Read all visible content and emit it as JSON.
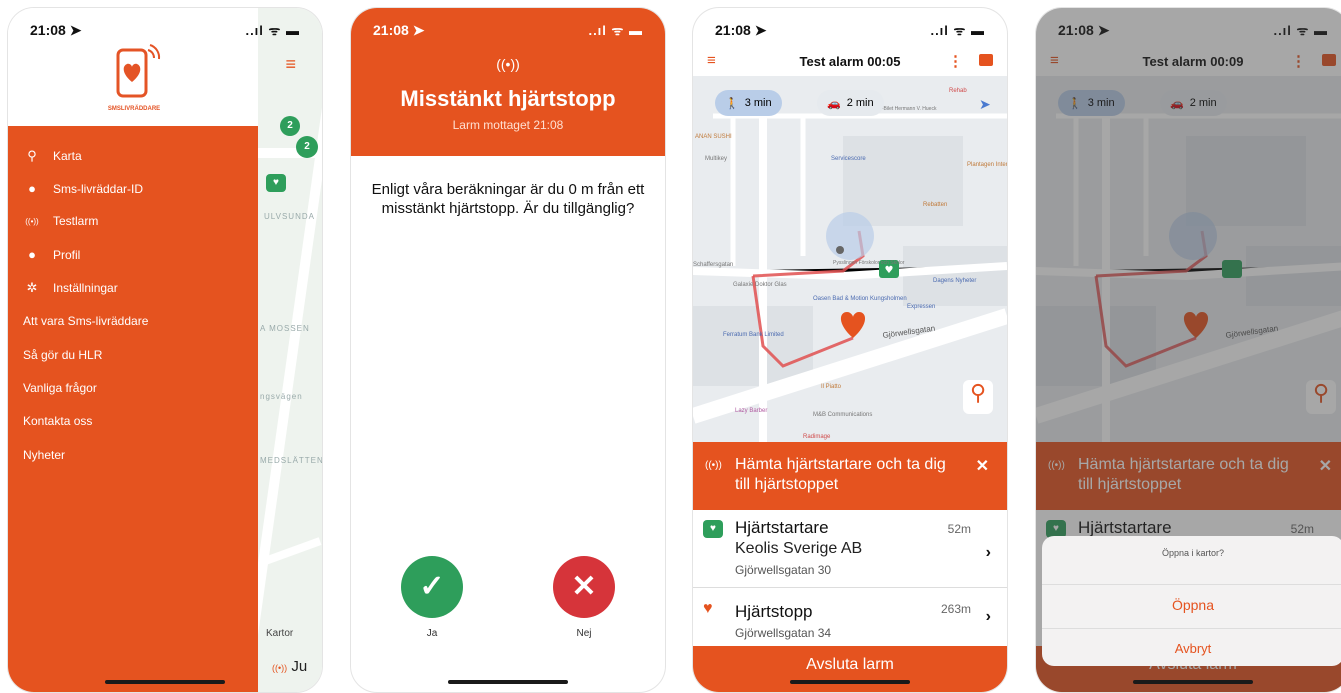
{
  "status": {
    "time1": "21:08 ➤",
    "time2": "21:08 ➤",
    "time3": "21:08 ➤",
    "time4": "21:08 ➤",
    "signal": "..ıl ᯤ ▬"
  },
  "phone1": {
    "logo_caption": "SMSLIVRÄDDARE",
    "menu": [
      {
        "icon": "⚲",
        "label": "Karta"
      },
      {
        "icon": "●",
        "label": "Sms-livräddar-ID"
      },
      {
        "icon": "((•))",
        "label": "Testlarm"
      },
      {
        "icon": "●",
        "label": "Profil"
      },
      {
        "icon": "✲",
        "label": "Inställningar"
      },
      {
        "label": "Att vara Sms-livräddare"
      },
      {
        "label": "Så gör du HLR"
      },
      {
        "label": "Vanliga frågor"
      },
      {
        "label": "Kontakta oss"
      },
      {
        "label": "Nyheter"
      }
    ],
    "map_labels": [
      "ULVSUNDA",
      "A MOSSEN",
      "ngsvägen",
      "MEDSLÄTTEN"
    ],
    "kartor": "Kartor",
    "ju": "Ju",
    "pin_counts": [
      "2",
      "2"
    ]
  },
  "phone2": {
    "radio": "((•))",
    "title": "Misstänkt hjärtstopp",
    "subtitle": "Larm mottaget 21:08",
    "message": "Enligt våra beräkningar är du 0 m från ett misstänkt hjärtstopp. Är du tillgänglig?",
    "yes_label": "Ja",
    "no_label": "Nej",
    "yes_glyph": "✓",
    "no_glyph": "✕"
  },
  "phone3": {
    "title": "Test alarm 00:05",
    "walk": "3 min",
    "car": "2 min",
    "banner": "Hämta hjärtstartare och ta dig till hjärtstoppet",
    "aed_title": "Hjärtstartare",
    "aed_dist": "52m",
    "aed_company": "Keolis Sverige AB",
    "aed_address": "Gjörwellsgatan 30",
    "arrest_title": "Hjärtstopp",
    "arrest_dist": "263m",
    "arrest_address": "Gjörwellsgatan 34",
    "footer": "Avsluta larm"
  },
  "phone4": {
    "title": "Test alarm 00:09",
    "walk": "3 min",
    "car": "2 min",
    "banner": "Hämta hjärtstartare och ta dig till hjärtstoppet",
    "aed_title": "Hjärtstartare",
    "aed_dist": "52m",
    "sheet_question": "Öppna i kartor?",
    "sheet_open": "Öppna",
    "sheet_cancel": "Avbryt",
    "footer": "Avsluta larm"
  },
  "map_labels": {
    "anan": "ANAN SUSHI",
    "multikey": "Multikey",
    "servicescore": "Servicescore",
    "rebatten": "Rebatten",
    "plantagen": "Plantagen Internationell",
    "schaffer": "Schaffersgatan",
    "galaxie": "Galaxie Doktor Glas",
    "pysslingen": "Pysslingen Förskolor och Skolor",
    "dagens": "Dagens Nyheter",
    "oasen": "Oasen Bad & Motion Kungsholmen",
    "expressen": "Expressen",
    "ferratum": "Ferratum Bank Limited",
    "gjorwell": "Gjörwellsgatan",
    "ilpiatto": "Il Piatto",
    "lazy": "Lazy Barber",
    "mb": "M&B Communications",
    "radimage": "Radimage",
    "hvh": "Hvh-Bilet Hermann V. Hueck",
    "rehab": "Rehab"
  },
  "colors": {
    "brand": "#e5531f",
    "aed_green": "#2e9e5b",
    "no_red": "#d6343a",
    "eta_blue": "#b9cde8"
  }
}
